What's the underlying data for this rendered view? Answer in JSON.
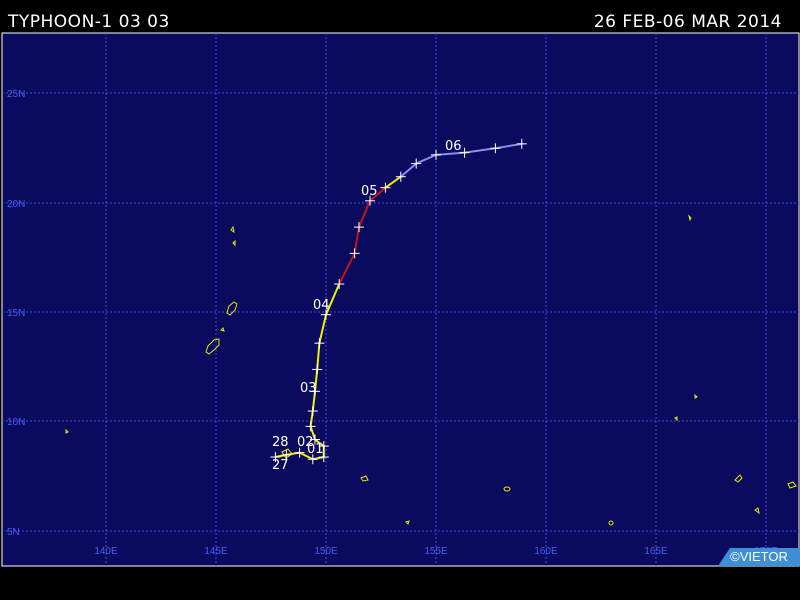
{
  "header": {
    "title": "TYPHOON-1 03 03",
    "period": "26 FEB-06 MAR 2014"
  },
  "credit": "©VIETOR",
  "colors": {
    "ocean": "#0a0a5e",
    "grid": "#3a4fd8",
    "axis_label": "#4a5cf0",
    "land": "#e8e800",
    "track_tropical_storm": "#f0f000",
    "track_typhoon": "#c41414",
    "track_extratropical": "#8c8cf0"
  },
  "axes": {
    "lon_labels": [
      "140E",
      "145E",
      "150E",
      "155E",
      "160E",
      "165E",
      "170E"
    ],
    "lat_labels": [
      "25N",
      "20N",
      "15N",
      "10N",
      "5N"
    ]
  },
  "date_labels": [
    "27",
    "28",
    "01",
    "02",
    "03",
    "04",
    "05",
    "06"
  ],
  "track": [
    {
      "lon": 147.7,
      "lat": 8.4,
      "stage": "ts"
    },
    {
      "lon": 148.2,
      "lat": 8.5,
      "stage": "ts"
    },
    {
      "lon": 148.8,
      "lat": 8.6,
      "stage": "ts"
    },
    {
      "lon": 149.4,
      "lat": 8.3,
      "stage": "ts"
    },
    {
      "lon": 149.9,
      "lat": 8.4,
      "stage": "ts"
    },
    {
      "lon": 149.9,
      "lat": 8.9,
      "stage": "ts"
    },
    {
      "lon": 149.5,
      "lat": 9.2,
      "stage": "ts"
    },
    {
      "lon": 149.3,
      "lat": 9.8,
      "stage": "ts"
    },
    {
      "lon": 149.4,
      "lat": 10.5,
      "stage": "ts"
    },
    {
      "lon": 149.5,
      "lat": 11.4,
      "stage": "ts"
    },
    {
      "lon": 149.6,
      "lat": 12.4,
      "stage": "ts"
    },
    {
      "lon": 149.7,
      "lat": 13.6,
      "stage": "ts"
    },
    {
      "lon": 150.0,
      "lat": 14.9,
      "stage": "ts"
    },
    {
      "lon": 150.6,
      "lat": 16.3,
      "stage": "ts"
    },
    {
      "lon": 151.3,
      "lat": 17.7,
      "stage": "ty"
    },
    {
      "lon": 151.5,
      "lat": 18.9,
      "stage": "ty"
    },
    {
      "lon": 152.0,
      "lat": 20.1,
      "stage": "ty"
    },
    {
      "lon": 152.7,
      "lat": 20.7,
      "stage": "ty"
    },
    {
      "lon": 153.4,
      "lat": 21.2,
      "stage": "ts"
    },
    {
      "lon": 154.1,
      "lat": 21.8,
      "stage": "et"
    },
    {
      "lon": 155.0,
      "lat": 22.2,
      "stage": "et"
    },
    {
      "lon": 156.3,
      "lat": 22.3,
      "stage": "et"
    },
    {
      "lon": 157.7,
      "lat": 22.5,
      "stage": "et"
    },
    {
      "lon": 158.9,
      "lat": 22.7,
      "stage": "et"
    }
  ]
}
